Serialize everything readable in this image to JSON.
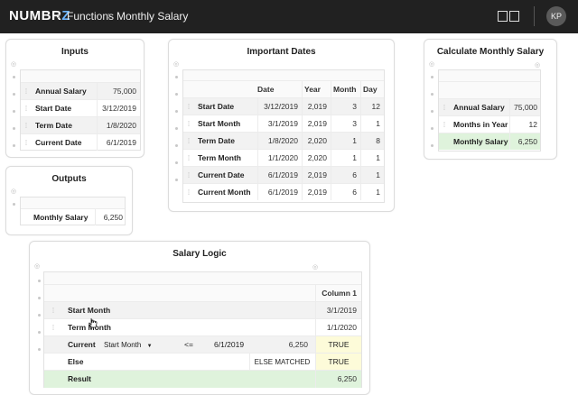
{
  "header": {
    "logo_main": "NUMBR",
    "logo_accent": "Z",
    "breadcrumb": [
      "Functions",
      "Monthly Salary"
    ],
    "user_initials": "KP"
  },
  "inputs": {
    "title": "Inputs",
    "rows": [
      {
        "label": "Annual Salary",
        "value": "75,000"
      },
      {
        "label": "Start Date",
        "value": "3/12/2019"
      },
      {
        "label": "Term Date",
        "value": "1/8/2020"
      },
      {
        "label": "Current Date",
        "value": "6/1/2019"
      }
    ]
  },
  "outputs": {
    "title": "Outputs",
    "rows": [
      {
        "label": "Monthly Salary",
        "value": "6,250"
      }
    ]
  },
  "dates": {
    "title": "Important Dates",
    "columns": [
      "Date",
      "Year",
      "Month",
      "Day"
    ],
    "rows": [
      {
        "label": "Start Date",
        "date": "3/12/2019",
        "year": "2,019",
        "month": "3",
        "day": "12"
      },
      {
        "label": "Start Month",
        "date": "3/1/2019",
        "year": "2,019",
        "month": "3",
        "day": "1"
      },
      {
        "label": "Term Date",
        "date": "1/8/2020",
        "year": "2,020",
        "month": "1",
        "day": "8"
      },
      {
        "label": "Term Month",
        "date": "1/1/2020",
        "year": "2,020",
        "month": "1",
        "day": "1"
      },
      {
        "label": "Current Date",
        "date": "6/1/2019",
        "year": "2,019",
        "month": "6",
        "day": "1"
      },
      {
        "label": "Current Month",
        "date": "6/1/2019",
        "year": "2,019",
        "month": "6",
        "day": "1"
      }
    ]
  },
  "calc": {
    "title": "Calculate Monthly Salary",
    "rows": [
      {
        "label": "Annual Salary",
        "value": "75,000"
      },
      {
        "label": "Months in Year",
        "value": "12"
      },
      {
        "label": "Monthly Salary",
        "value": "6,250"
      }
    ]
  },
  "logic": {
    "title": "Salary Logic",
    "column_header": "Column 1",
    "start_month": {
      "label": "Start Month",
      "value": "3/1/2019"
    },
    "term_month": {
      "label": "Term Month",
      "value": "1/1/2020"
    },
    "current": {
      "label": "Current",
      "select": "Start Month",
      "operator": "<=",
      "date": "6/1/2019",
      "amount": "6,250",
      "result": "TRUE"
    },
    "else_row": {
      "label": "Else",
      "matched": "ELSE MATCHED",
      "result": "TRUE"
    },
    "result": {
      "label": "Result",
      "value": "6,250"
    }
  }
}
